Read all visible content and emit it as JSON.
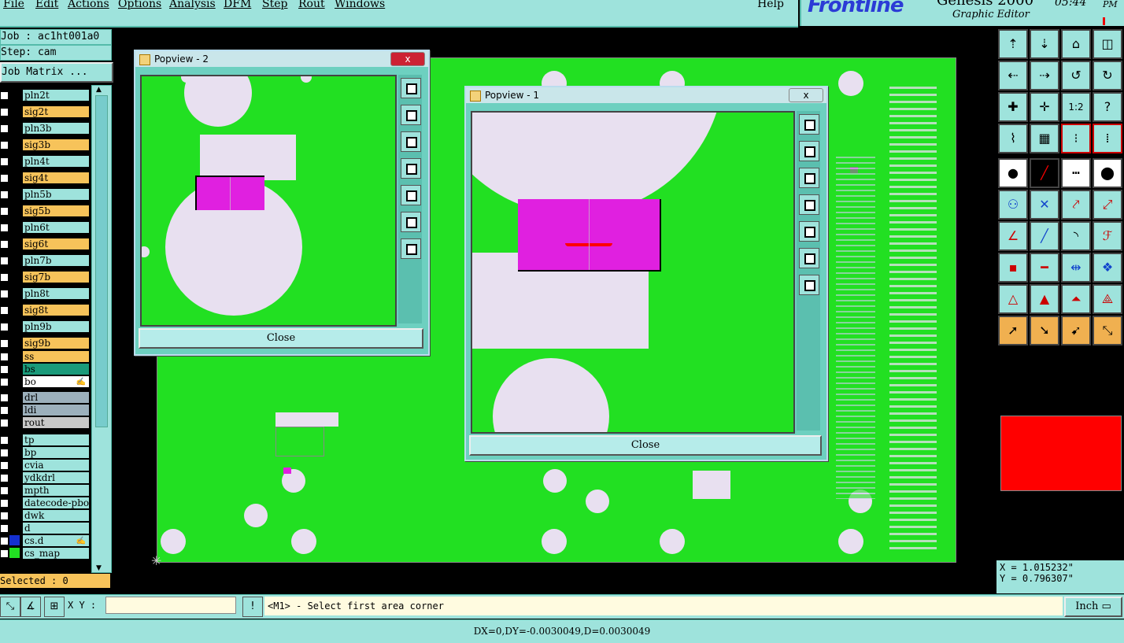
{
  "menu": {
    "items": [
      "File",
      "Edit",
      "Actions",
      "Options",
      "Analysis",
      "DFM",
      "Step",
      "Rout",
      "Windows"
    ],
    "help": "Help"
  },
  "brand": {
    "logo": "Frontline",
    "product": "Genesis 2000",
    "subtitle": "Graphic Editor",
    "time": "05:44",
    "ampm": "PM"
  },
  "job": {
    "job_label": "Job : ac1ht001a0",
    "step_label": "Step: cam",
    "matrix_button": "Job Matrix ..."
  },
  "layers": [
    {
      "name": "pln2t",
      "color": "#9ee3dc"
    },
    {
      "name": "sig2t",
      "color": "#f7c35a"
    },
    {
      "name": "pln3b",
      "color": "#9ee3dc"
    },
    {
      "name": "sig3b",
      "color": "#f7c35a"
    },
    {
      "name": "pln4t",
      "color": "#9ee3dc"
    },
    {
      "name": "sig4t",
      "color": "#f7c35a"
    },
    {
      "name": "pln5b",
      "color": "#9ee3dc"
    },
    {
      "name": "sig5b",
      "color": "#f7c35a"
    },
    {
      "name": "pln6t",
      "color": "#9ee3dc"
    },
    {
      "name": "sig6t",
      "color": "#f7c35a"
    },
    {
      "name": "pln7b",
      "color": "#9ee3dc"
    },
    {
      "name": "sig7b",
      "color": "#f7c35a"
    },
    {
      "name": "pln8t",
      "color": "#9ee3dc"
    },
    {
      "name": "sig8t",
      "color": "#f7c35a"
    },
    {
      "name": "pln9b",
      "color": "#9ee3dc"
    },
    {
      "name": "sig9b",
      "color": "#f7c35a"
    },
    {
      "name": "ss",
      "color": "#f7c35a"
    },
    {
      "name": "bs",
      "color": "#1a9a7a"
    },
    {
      "name": "bo",
      "color": "#ffffff"
    },
    {
      "name": "drl",
      "color": "#9cb0bc"
    },
    {
      "name": "ldi",
      "color": "#9cb0bc"
    },
    {
      "name": "rout",
      "color": "#c8c8c8"
    },
    {
      "name": "tp",
      "color": "#9ee3dc"
    },
    {
      "name": "bp",
      "color": "#9ee3dc"
    },
    {
      "name": "cvia",
      "color": "#9ee3dc"
    },
    {
      "name": "ydkdrl",
      "color": "#9ee3dc"
    },
    {
      "name": "mpth",
      "color": "#9ee3dc"
    },
    {
      "name": "datecode-pbo",
      "color": "#9ee3dc"
    },
    {
      "name": "dwk",
      "color": "#9ee3dc"
    },
    {
      "name": "d",
      "color": "#9ee3dc"
    },
    {
      "name": "cs.d",
      "color": "#9ee3dc"
    },
    {
      "name": "cs_map",
      "color": "#9ee3dc"
    }
  ],
  "selected_label": "Selected : 0",
  "popview2": {
    "title": "Popview - 2",
    "close": "Close",
    "x": "x"
  },
  "popview1": {
    "title": "Popview - 1",
    "close": "Close",
    "x": "x"
  },
  "coords": {
    "x": "X = 1.015232\"",
    "y": "Y = 0.796307\""
  },
  "command": {
    "xy_label": "X Y :",
    "xy_value": "",
    "prompt": "<M1> - Select first area corner",
    "units": "Inch"
  },
  "status": "DX=0,DY=-0.0030049,D=0.0030049",
  "colors": {
    "panel": "#9ee3dc",
    "board": "#22e022",
    "highlight": "#e020e0",
    "alert": "#ff0000"
  }
}
